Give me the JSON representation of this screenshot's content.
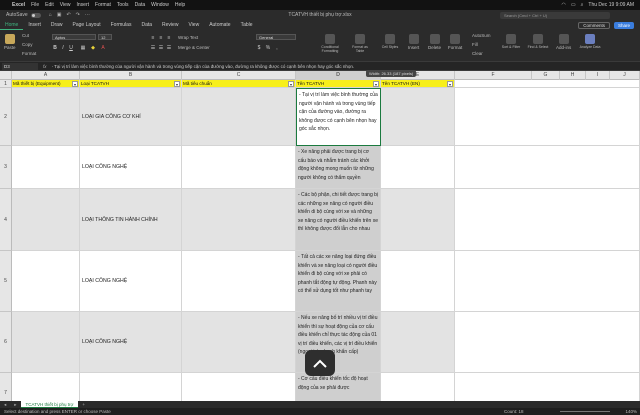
{
  "menubar": {
    "app": "Excel",
    "items": [
      "File",
      "Edit",
      "View",
      "Insert",
      "Format",
      "Tools",
      "Data",
      "Window",
      "Help"
    ],
    "clock": "Thu Dec 19  9:09 AM"
  },
  "titlebar": {
    "autosave": "AutoSave",
    "title": "TCATVH thiết bị phụ trợ.xlsx",
    "search": "Search (Cmd + Ctrl + U)"
  },
  "tabs": [
    "Home",
    "Insert",
    "Draw",
    "Page Layout",
    "Formulas",
    "Data",
    "Review",
    "View",
    "Automate",
    "Table"
  ],
  "active_tab": "Home",
  "comments_label": "Comments",
  "share_label": "Share",
  "ribbon": {
    "paste": "Paste",
    "cut": "Cut",
    "copy": "Copy",
    "format": "Format",
    "font_name": "Aptos",
    "font_size": "12",
    "wrap_text": "Wrap Text",
    "merge": "Merge & Center",
    "number_format": "General",
    "conditional": "Conditional Formatting",
    "format_table": "Format as Table",
    "cell_styles": "Cell Styles",
    "insert": "Insert",
    "delete": "Delete",
    "format_cells": "Format",
    "autosum": "AutoSum",
    "fill": "Fill",
    "clear": "Clear",
    "sort_filter": "Sort & Filter",
    "find_select": "Find & Select",
    "addins": "Add-ins",
    "analyze": "Analyze Data"
  },
  "formula_bar": {
    "namebox": "D3",
    "fx": "fx",
    "content": "- Tại vị trí làm việc bình thường của người vận hành và trong vùng tiếp cận của đường vào, đường ra không được có cạnh bên nhọn hay góc sắc nhọn."
  },
  "tooltip": "Width: 26.33 (187 pixels)",
  "columns": [
    "A",
    "B",
    "C",
    "D",
    "E",
    "F",
    "G",
    "H",
    "I",
    "J"
  ],
  "header_row": {
    "a": "Mã thiết bị (Equipment)",
    "b": "Loại TCATVH",
    "c": "Mã tiêu chuẩn",
    "d": "Tên TCATVH",
    "e": "Tên TCATVH (EN)"
  },
  "rows": [
    {
      "num": "2",
      "b": "LOẠI GIA CÔNG CƠ KHÍ",
      "d": "- Tại vị trí làm việc bình thường của người vận hành và trong vùng tiếp cận của đường vào, đường ra không được có cạnh bên nhọn hay góc sắc nhọn."
    },
    {
      "num": "3",
      "b": "LOẠI CÔNG NGHỆ",
      "d": "- Xe nâng phải được trang bị cơ cấu báo và nhắm tránh các khởi động không mong muốn từ những người không có thẩm quyền"
    },
    {
      "num": "4",
      "b": "LOẠI THÔNG TIN HÀNH CHÍNH",
      "d": "- Các bộ phận, chi tiết được trang bị các những xe nâng có người điều khiển di bộ cùng với xe và những xe nâng có người điều khiển trên xe thì không được đổi lẫn cho nhau"
    },
    {
      "num": "5",
      "b": "LOẠI CÔNG NGHỆ",
      "d": "- Tất cả các xe nâng loại đứng điều khiển và xe nâng loại có người điều khiển đi bộ cùng với xe phải có phanh tắt động tự động. Phanh này có thể sử dụng tốt như phanh tay"
    },
    {
      "num": "6",
      "b": "LOẠI CÔNG NGHỆ",
      "d": "- Nếu xe nâng bố trí nhiều vị trí điều khiển thì sự hoạt động của cơ cấu điều khiển chỉ thực tác động của 01 vị trí điều khiển, các vị trí điều khiển (ngoại trừ phanh khẩn cấp)"
    },
    {
      "num": "7",
      "b": "",
      "d": "- Cơ cấu điều khiển tốc độ hoạt động của xe phải được"
    }
  ],
  "sheet_tab": "TCATVH thiết bị phụ trợ",
  "status": {
    "message": "Select destination and press ENTER or choose Paste",
    "count": "Count: 18",
    "zoom": "140%"
  }
}
